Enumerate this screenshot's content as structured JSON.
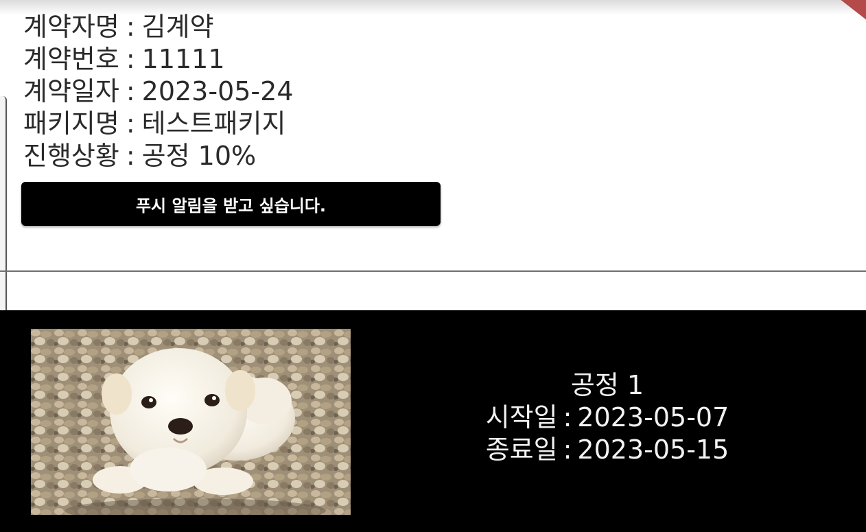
{
  "contract_info": {
    "rows": [
      {
        "label": "계약자명",
        "separator": ":",
        "value": "김계약"
      },
      {
        "label": "계약번호",
        "separator": ":",
        "value": "11111"
      },
      {
        "label": "계약일자",
        "separator": ":",
        "value": "2023-05-24"
      },
      {
        "label": "패키지명",
        "separator": ":",
        "value": "테스트패키지"
      },
      {
        "label": "진행상황",
        "separator": ":",
        "value": "공정 10%"
      }
    ]
  },
  "push_button": {
    "label": "푸시 알림을 받고 싶습니다."
  },
  "process_card": {
    "image_icon": "puppy-photo",
    "title": "공정 1",
    "start": {
      "label": "시작일",
      "separator": ":",
      "value": "2023-05-07"
    },
    "end": {
      "label": "종료일",
      "separator": ":",
      "value": "2023-05-15"
    }
  },
  "colors": {
    "card_background": "#000000",
    "button_background": "#000000",
    "page_background": "#ffffff",
    "debug_banner": "#b44a4a"
  }
}
